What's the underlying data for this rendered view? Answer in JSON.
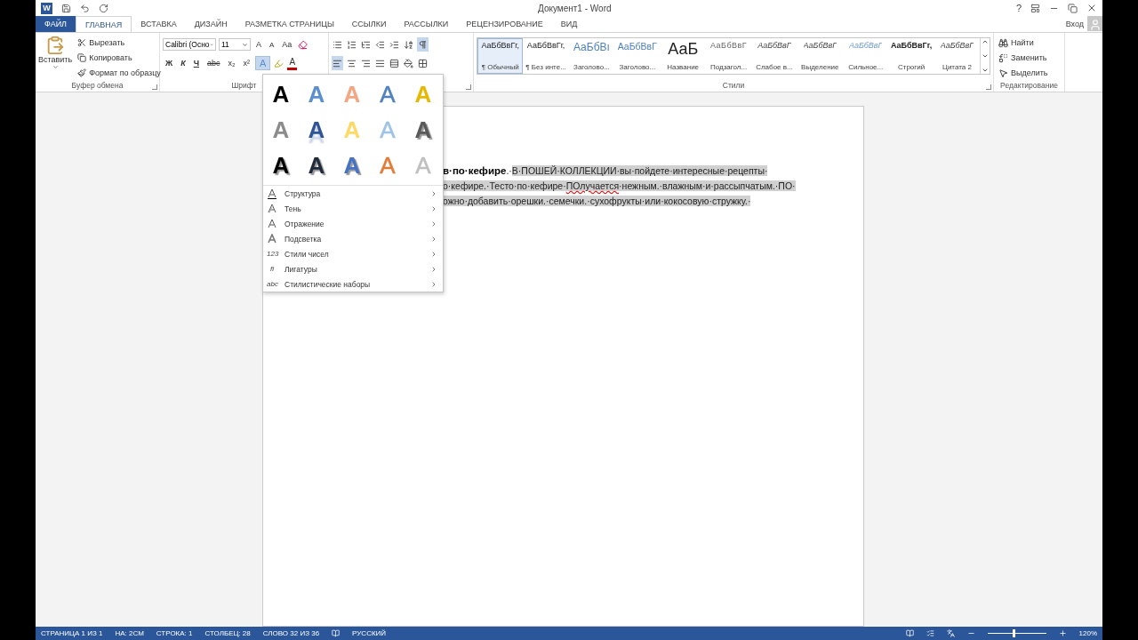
{
  "title_bar": {
    "logo": "W",
    "title": "Документ1 - Word",
    "help": "?"
  },
  "tabs": [
    {
      "label": "ФАЙЛ",
      "kind": "file",
      "selected": false
    },
    {
      "label": "ГЛАВНАЯ",
      "kind": "tab",
      "selected": true
    },
    {
      "label": "ВСТАВКА",
      "kind": "tab",
      "selected": false
    },
    {
      "label": "ДИЗАЙН",
      "kind": "tab",
      "selected": false
    },
    {
      "label": "РАЗМЕТКА СТРАНИЦЫ",
      "kind": "tab",
      "selected": false
    },
    {
      "label": "ССЫЛКИ",
      "kind": "tab",
      "selected": false
    },
    {
      "label": "РАССЫЛКИ",
      "kind": "tab",
      "selected": false
    },
    {
      "label": "РЕЦЕНЗИРОВАНИЕ",
      "kind": "tab",
      "selected": false
    },
    {
      "label": "ВИД",
      "kind": "tab",
      "selected": false
    }
  ],
  "account": {
    "label": "Вход"
  },
  "clipboard": {
    "paste": "Вставить",
    "items": [
      {
        "label": "Вырезать",
        "kind": "cut"
      },
      {
        "label": "Копировать",
        "kind": "copy"
      },
      {
        "label": "Формат по образцу",
        "kind": "format"
      }
    ],
    "group_label": "Буфер обмена"
  },
  "font": {
    "name": "Calibri (Осно",
    "size": "11",
    "grow": "A",
    "shrink": "A",
    "case": "Aa",
    "format_buttons": [
      {
        "label": "Ж",
        "kind": "bold"
      },
      {
        "label": "К",
        "kind": "italic"
      },
      {
        "label": "Ч",
        "kind": "underline"
      },
      {
        "label": "abc",
        "kind": "strike"
      },
      {
        "label": "x₂",
        "kind": "plain"
      },
      {
        "label": "x²",
        "kind": "plain"
      }
    ],
    "effects_button": {
      "label": "A",
      "selected": true
    },
    "color_button": "A",
    "group_label": "Шрифт"
  },
  "paragraph": {
    "align": [
      {
        "kind": "left",
        "selected": true
      },
      {
        "kind": "center",
        "selected": false
      },
      {
        "kind": "right",
        "selected": false
      },
      {
        "kind": "justify",
        "selected": false
      }
    ],
    "show_marks": {
      "selected": true
    }
  },
  "styles": {
    "items": [
      {
        "preview": "АаБбВвГг,",
        "label": "¶ Обычный",
        "kind": "normal",
        "selected": true
      },
      {
        "preview": "АаБбВвГг,",
        "label": "¶ Без инте...",
        "kind": "normal",
        "selected": false
      },
      {
        "preview": "АаБбВı",
        "label": "Заголово...",
        "kind": "heading1",
        "selected": false
      },
      {
        "preview": "АаБбВвГ",
        "label": "Заголово...",
        "kind": "heading2",
        "selected": false
      },
      {
        "preview": "АаБ",
        "label": "Название",
        "kind": "title",
        "selected": false
      },
      {
        "preview": "АаБбВвГ",
        "label": "Подзагол...",
        "kind": "subtitle",
        "selected": false
      },
      {
        "preview": "АаБбВвГ",
        "label": "Слабое в...",
        "kind": "italic",
        "selected": false
      },
      {
        "preview": "АаБбВвГ",
        "label": "Выделение",
        "kind": "italic",
        "selected": false
      },
      {
        "preview": "АаБбВвГ",
        "label": "Сильное...",
        "kind": "strong-italic",
        "selected": false
      },
      {
        "preview": "АаБбВвГг,",
        "label": "Строгий",
        "kind": "bold",
        "selected": false
      },
      {
        "preview": "АаБбВвГ",
        "label": "Цитата 2",
        "kind": "italic",
        "selected": false
      }
    ],
    "group_label": "Стили"
  },
  "editing": {
    "items": [
      {
        "label": "Найти",
        "kind": "find"
      },
      {
        "label": "Заменить",
        "kind": "replace"
      },
      {
        "label": "Выделить",
        "kind": "select"
      }
    ],
    "group_label": "Редактирование"
  },
  "effects_menu": {
    "gallery": [
      {
        "letter": "A",
        "kind": "fill",
        "color": "#000000"
      },
      {
        "letter": "A",
        "kind": "fill",
        "color": "#5b8fd0"
      },
      {
        "letter": "A",
        "kind": "fill",
        "color": "#f4a582"
      },
      {
        "letter": "A",
        "kind": "outline",
        "color": "#4f81bd"
      },
      {
        "letter": "A",
        "kind": "fill",
        "color": "#e6b800"
      },
      {
        "letter": "A",
        "kind": "fill",
        "color": "#8c8c8c"
      },
      {
        "letter": "A",
        "kind": "reflect",
        "color": "#2f5597"
      },
      {
        "letter": "A",
        "kind": "fill",
        "color": "#ffd966"
      },
      {
        "letter": "A",
        "kind": "outline",
        "color": "#9dc3e6"
      },
      {
        "letter": "A",
        "kind": "shadow",
        "color": "#595959"
      },
      {
        "letter": "A",
        "kind": "shadow",
        "color": "#000000"
      },
      {
        "letter": "A",
        "kind": "shadow",
        "color": "#1f2a3a"
      },
      {
        "letter": "A",
        "kind": "shadow",
        "color": "#4472c4"
      },
      {
        "letter": "A",
        "kind": "outline",
        "color": "#e07b39"
      },
      {
        "letter": "A",
        "kind": "outline",
        "color": "#bfbfbf"
      }
    ],
    "items": [
      {
        "label": "Структура",
        "kind": "outline"
      },
      {
        "label": "Тень",
        "kind": "shadow"
      },
      {
        "label": "Отражение",
        "kind": "reflection"
      },
      {
        "label": "Подсветка",
        "kind": "glow"
      },
      {
        "label": "Стили чисел",
        "kind": "glyph",
        "icon": "123"
      },
      {
        "label": "Лигатуры",
        "kind": "glyph",
        "icon": "fi"
      },
      {
        "label": "Стилистические наборы",
        "kind": "glyph",
        "icon": "abc"
      }
    ]
  },
  "document": {
    "lines": [
      {
        "segments": [
          {
            "text": "в·по·кефире",
            "bold": true,
            "selected": false,
            "misspelled": false
          },
          {
            "text": ".·",
            "bold": false,
            "selected": false,
            "misspelled": false
          },
          {
            "text": "В·ПОШЕЙ·КОЛЛЕКЦИИ·вы·пойдете·интересные·рецепты·",
            "bold": false,
            "selected": true,
            "misspelled": false
          }
        ]
      },
      {
        "segments": [
          {
            "text": "о·кефире.·Тесто·по·кефире·",
            "bold": false,
            "selected": true,
            "misspelled": false
          },
          {
            "text": "ПОлучается",
            "bold": false,
            "selected": true,
            "misspelled": true
          },
          {
            "text": "·нежным.·влажным·и·рассыпчатым.·ПО·",
            "bold": false,
            "selected": true,
            "misspelled": false
          }
        ]
      },
      {
        "segments": [
          {
            "text": "ожно·добавить·орешки.·семечки.·сухофрукты·или·кокосовую·стружку.·",
            "bold": false,
            "selected": true,
            "misspelled": false
          }
        ]
      }
    ]
  },
  "status_bar": {
    "items": [
      "СТРАНИЦА 1 ИЗ 1",
      "НА: 2СМ",
      "СТРОКА: 1",
      "СТОЛБЕЦ: 28",
      "СЛОВО 32 ИЗ 36"
    ],
    "language": "РУССКИЙ",
    "zoom_slider": {
      "level": 0.43
    },
    "zoom": "120%"
  }
}
